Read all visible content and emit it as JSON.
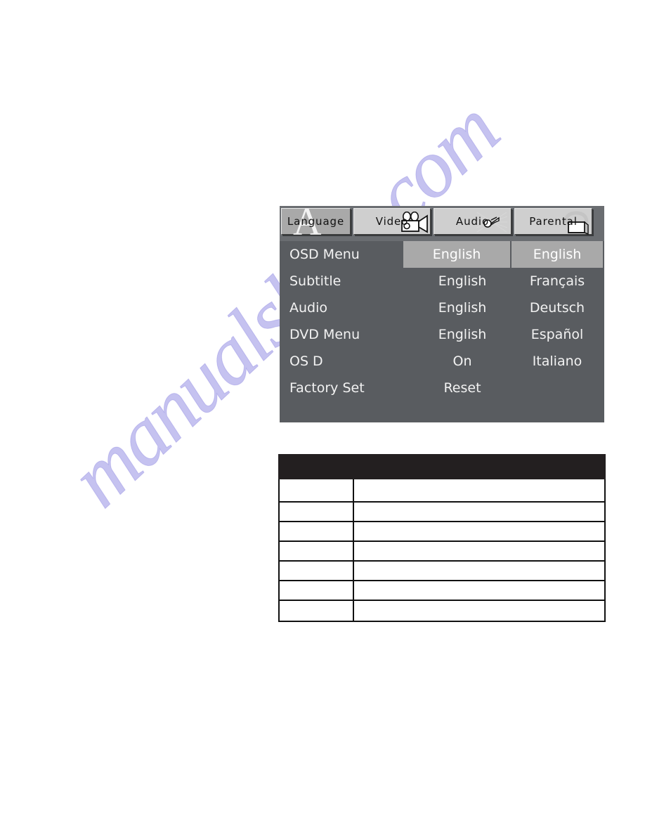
{
  "watermark": {
    "text": "manualshive.com"
  },
  "colors": {
    "panel_background": "#595c60",
    "tabstrip_background": "#6a6d71",
    "tab_active": "#a9a9a9",
    "tab_inactive": "#cfcfcf",
    "highlight": "#a9a9a9",
    "text_light": "#f2f2f2",
    "table_header": "#231f20",
    "table_border": "#111111",
    "watermark_color": "#564cd2"
  },
  "osd": {
    "tabs": [
      {
        "label": "Language",
        "icon": "letter-a-icon",
        "active": true
      },
      {
        "label": "Video",
        "icon": "movie-camera-icon",
        "active": false
      },
      {
        "label": "Audio",
        "icon": "sound-wave-icon",
        "active": false
      },
      {
        "label": "Parental",
        "icon": "tv-screen-icon",
        "active": false
      }
    ],
    "rows": [
      {
        "label": "OSD Menu",
        "value": "English",
        "value_selected": true,
        "option": "English",
        "option_selected": true
      },
      {
        "label": "Subtitle",
        "value": "English",
        "value_selected": false,
        "option": "Français",
        "option_selected": false
      },
      {
        "label": "Audio",
        "value": "English",
        "value_selected": false,
        "option": "Deutsch",
        "option_selected": false
      },
      {
        "label": "DVD Menu",
        "value": "English",
        "value_selected": false,
        "option": "Español",
        "option_selected": false
      },
      {
        "label": "OS D",
        "value": "On",
        "value_selected": false,
        "option": "Italiano",
        "option_selected": false
      },
      {
        "label": "Factory Set",
        "value": "Reset",
        "value_selected": false,
        "option": "",
        "option_selected": false
      }
    ]
  },
  "spec_table": {
    "header": "",
    "rows": [
      {
        "left": "",
        "right": "",
        "tall": true
      },
      {
        "left": "",
        "right": "",
        "tall": false
      },
      {
        "left": "",
        "right": "",
        "tall": false
      },
      {
        "left": "",
        "right": "",
        "tall": false
      },
      {
        "left": "",
        "right": "",
        "tall": false
      },
      {
        "left": "",
        "right": "",
        "tall": false
      },
      {
        "left": "",
        "right": "",
        "tall": false
      }
    ]
  }
}
